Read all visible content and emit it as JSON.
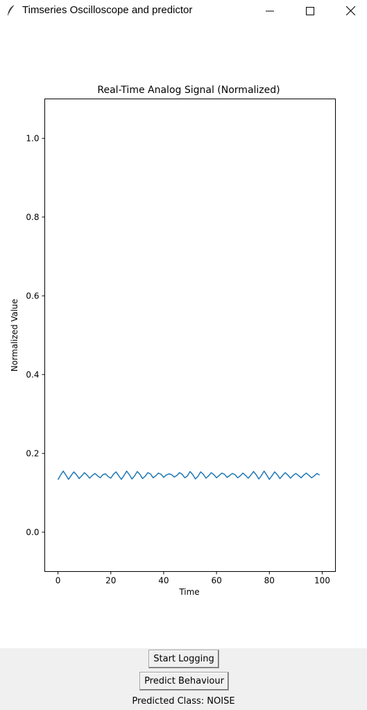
{
  "window": {
    "title": "Timseries Oscilloscope and predictor",
    "icon": "feather-icon"
  },
  "chart_data": {
    "type": "line",
    "title": "Real-Time Analog Signal (Normalized)",
    "xlabel": "Time",
    "ylabel": "Normalized Value",
    "xlim": [
      -5,
      105
    ],
    "ylim": [
      -0.1,
      1.1
    ],
    "xticks": [
      0,
      20,
      40,
      60,
      80,
      100
    ],
    "yticks": [
      0.0,
      0.2,
      0.4,
      0.6,
      0.8,
      1.0
    ],
    "grid": false,
    "line_color": "#1f77b4",
    "series": [
      {
        "x": [
          0,
          1,
          2,
          3,
          4,
          5,
          6,
          7,
          8,
          9,
          10,
          11,
          12,
          13,
          14,
          15,
          16,
          17,
          18,
          19,
          20,
          21,
          22,
          23,
          24,
          25,
          26,
          27,
          28,
          29,
          30,
          31,
          32,
          33,
          34,
          35,
          36,
          37,
          38,
          39,
          40,
          41,
          42,
          43,
          44,
          45,
          46,
          47,
          48,
          49,
          50,
          51,
          52,
          53,
          54,
          55,
          56,
          57,
          58,
          59,
          60,
          61,
          62,
          63,
          64,
          65,
          66,
          67,
          68,
          69,
          70,
          71,
          72,
          73,
          74,
          75,
          76,
          77,
          78,
          79,
          80,
          81,
          82,
          83,
          84,
          85,
          86,
          87,
          88,
          89,
          90,
          91,
          92,
          93,
          94,
          95,
          96,
          97,
          98,
          99
        ],
        "values": [
          0.133,
          0.145,
          0.155,
          0.145,
          0.134,
          0.144,
          0.153,
          0.146,
          0.136,
          0.143,
          0.151,
          0.145,
          0.137,
          0.144,
          0.149,
          0.143,
          0.138,
          0.146,
          0.148,
          0.141,
          0.137,
          0.147,
          0.153,
          0.143,
          0.134,
          0.144,
          0.155,
          0.146,
          0.135,
          0.143,
          0.154,
          0.147,
          0.136,
          0.142,
          0.151,
          0.148,
          0.138,
          0.143,
          0.15,
          0.147,
          0.139,
          0.145,
          0.148,
          0.146,
          0.14,
          0.144,
          0.151,
          0.147,
          0.138,
          0.143,
          0.154,
          0.146,
          0.135,
          0.142,
          0.153,
          0.147,
          0.137,
          0.143,
          0.151,
          0.146,
          0.138,
          0.144,
          0.15,
          0.147,
          0.139,
          0.144,
          0.149,
          0.146,
          0.138,
          0.143,
          0.15,
          0.144,
          0.137,
          0.145,
          0.154,
          0.146,
          0.135,
          0.144,
          0.155,
          0.145,
          0.134,
          0.143,
          0.153,
          0.146,
          0.136,
          0.144,
          0.151,
          0.145,
          0.137,
          0.144,
          0.149,
          0.144,
          0.138,
          0.145,
          0.15,
          0.144,
          0.138,
          0.143,
          0.149,
          0.145
        ]
      }
    ]
  },
  "controls": {
    "start_label": "Start Logging",
    "predict_label": "Predict Behaviour",
    "prediction_text": "Predicted Class: NOISE"
  }
}
